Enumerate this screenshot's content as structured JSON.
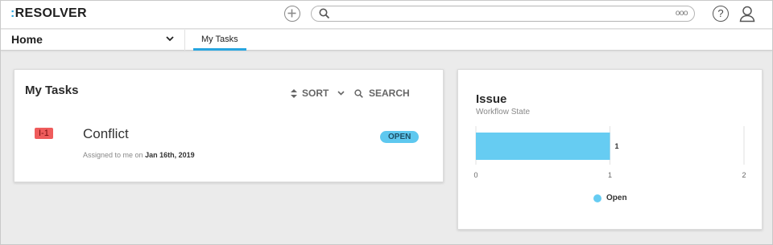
{
  "app": {
    "logo_mark": ":",
    "logo_text": "RESOLVER"
  },
  "topbar": {
    "add_icon": "plus-circle-icon",
    "search_placeholder": "",
    "search_options_label": "ooo",
    "help_label": "?",
    "user_icon": "user-icon"
  },
  "nav": {
    "home_label": "Home",
    "tabs": [
      {
        "label": "My Tasks",
        "active": true
      }
    ],
    "accent_color": "#27a5df"
  },
  "tasks_card": {
    "title": "My Tasks",
    "sort_label": "SORT",
    "search_label": "SEARCH",
    "items": [
      {
        "id": "I-1",
        "name": "Conflict",
        "assigned_prefix": "Assigned to me on",
        "assigned_date": "Jan 16th, 2019",
        "status": "OPEN",
        "id_color": "#ef5c5c",
        "status_color": "#5ec8ef"
      }
    ]
  },
  "issue_card": {
    "title": "Issue",
    "subtitle": "Workflow State"
  },
  "chart_data": {
    "type": "bar",
    "orientation": "horizontal",
    "categories": [
      "Open"
    ],
    "series": [
      {
        "name": "Open",
        "values": [
          1
        ],
        "color": "#66ccf2"
      }
    ],
    "data_labels": [
      "1"
    ],
    "x_ticks": [
      "0",
      "1",
      "2"
    ],
    "xlim": [
      0,
      2
    ],
    "grid": true,
    "legend": "bottom-center"
  }
}
